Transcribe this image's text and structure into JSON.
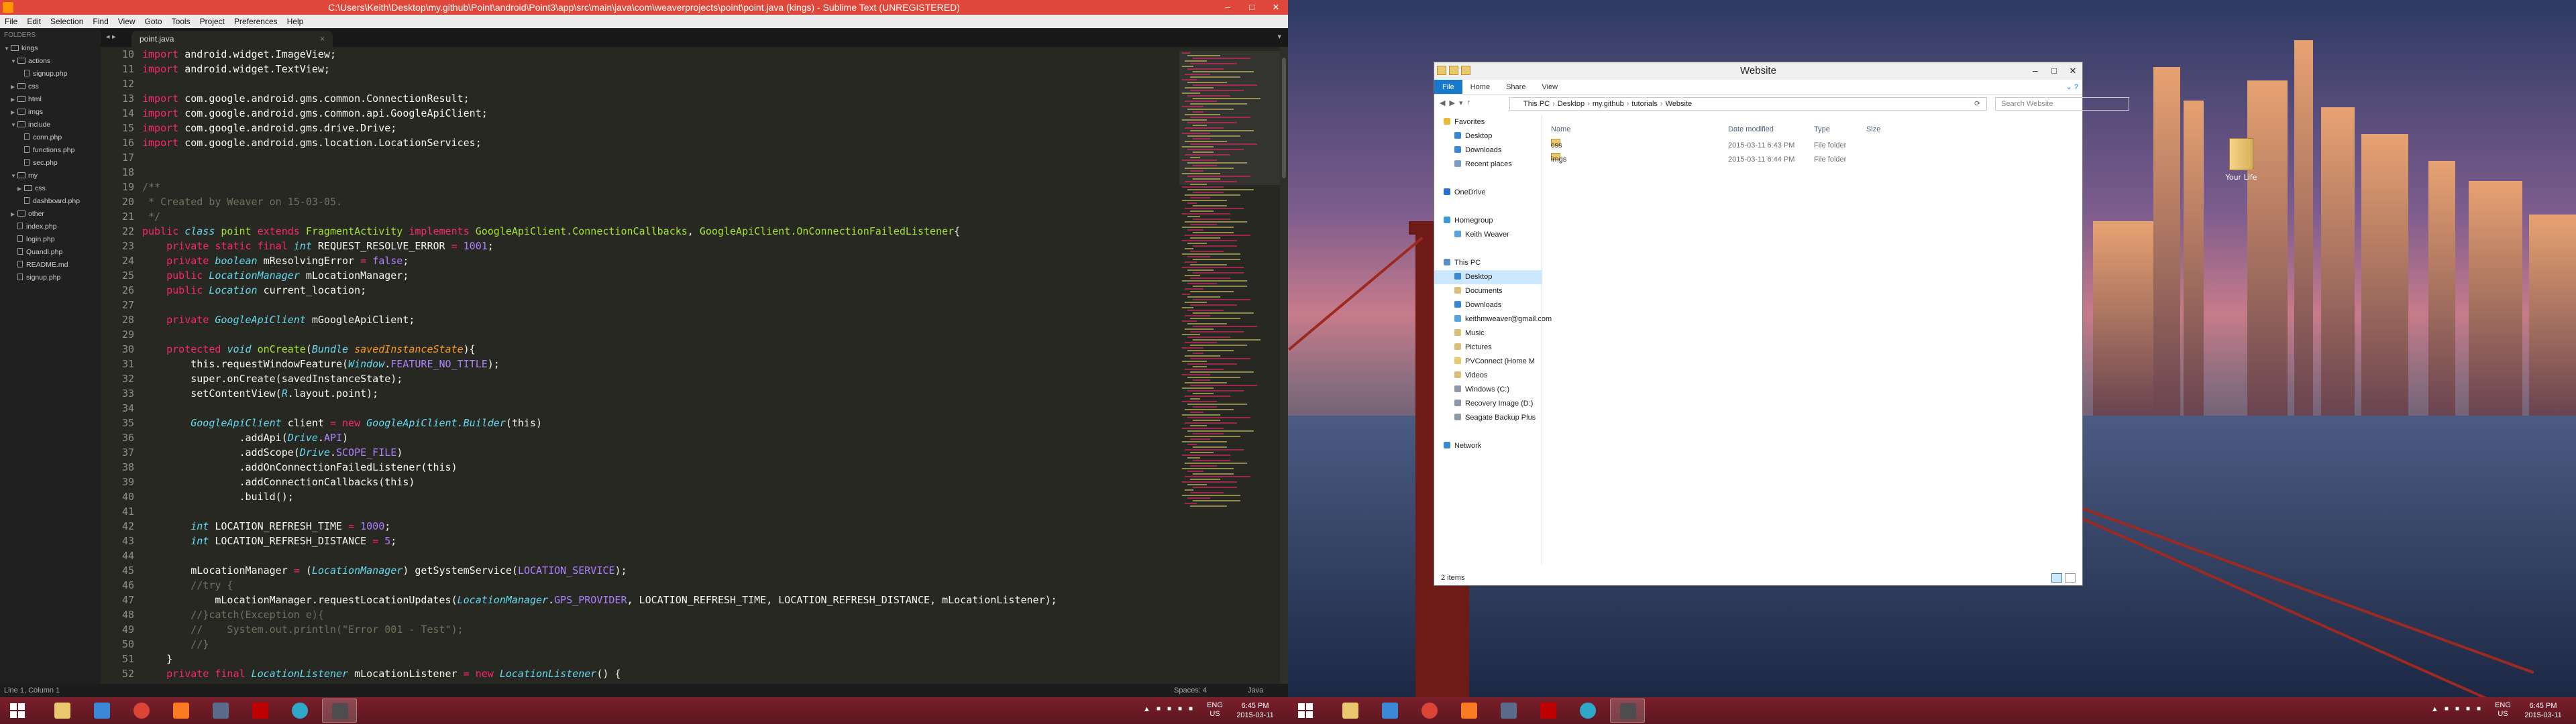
{
  "sublime": {
    "title": "C:\\Users\\Keith\\Desktop\\my.github\\Point\\android\\Point3\\app\\src\\main\\java\\com\\weaverprojects\\point\\point.java (kings) - Sublime Text (UNREGISTERED)",
    "menu": [
      "File",
      "Edit",
      "Selection",
      "Find",
      "View",
      "Goto",
      "Tools",
      "Project",
      "Preferences",
      "Help"
    ],
    "sidebar_header": "FOLDERS",
    "tree": [
      {
        "label": "kings",
        "kind": "folder",
        "open": true,
        "depth": 0
      },
      {
        "label": "actions",
        "kind": "folder",
        "open": true,
        "depth": 1
      },
      {
        "label": "signup.php",
        "kind": "file",
        "depth": 2
      },
      {
        "label": "css",
        "kind": "folder",
        "open": false,
        "depth": 1
      },
      {
        "label": "html",
        "kind": "folder",
        "open": false,
        "depth": 1
      },
      {
        "label": "imgs",
        "kind": "folder",
        "open": false,
        "depth": 1
      },
      {
        "label": "include",
        "kind": "folder",
        "open": true,
        "depth": 1
      },
      {
        "label": "conn.php",
        "kind": "file",
        "depth": 2
      },
      {
        "label": "functions.php",
        "kind": "file",
        "depth": 2
      },
      {
        "label": "sec.php",
        "kind": "file",
        "depth": 2
      },
      {
        "label": "my",
        "kind": "folder",
        "open": true,
        "depth": 1
      },
      {
        "label": "css",
        "kind": "folder",
        "open": false,
        "depth": 2
      },
      {
        "label": "dashboard.php",
        "kind": "file",
        "depth": 2
      },
      {
        "label": "other",
        "kind": "folder",
        "open": false,
        "depth": 1
      },
      {
        "label": "index.php",
        "kind": "file",
        "depth": 1
      },
      {
        "label": "login.php",
        "kind": "file",
        "depth": 1
      },
      {
        "label": "Quandl.php",
        "kind": "file",
        "depth": 1
      },
      {
        "label": "README.md",
        "kind": "file",
        "depth": 1
      },
      {
        "label": "signup.php",
        "kind": "file",
        "depth": 1
      }
    ],
    "tab": "point.java",
    "first_line": 10,
    "code": [
      [
        [
          "kw",
          "import "
        ],
        [
          "pl",
          "android.widget.ImageView;"
        ]
      ],
      [
        [
          "kw",
          "import "
        ],
        [
          "pl",
          "android.widget.TextView;"
        ]
      ],
      [],
      [
        [
          "kw",
          "import "
        ],
        [
          "pl",
          "com.google.android.gms.common.ConnectionResult;"
        ]
      ],
      [
        [
          "kw",
          "import "
        ],
        [
          "pl",
          "com.google.android.gms.common.api.GoogleApiClient;"
        ]
      ],
      [
        [
          "kw",
          "import "
        ],
        [
          "pl",
          "com.google.android.gms.drive.Drive;"
        ]
      ],
      [
        [
          "kw",
          "import "
        ],
        [
          "pl",
          "com.google.android.gms.location.LocationServices;"
        ]
      ],
      [],
      [],
      [
        [
          "cm",
          "/**"
        ]
      ],
      [
        [
          "cm",
          " * Created by Weaver on 15-03-05."
        ]
      ],
      [
        [
          "cm",
          " */"
        ]
      ],
      [
        [
          "kw",
          "public "
        ],
        [
          "ty",
          "class "
        ],
        [
          "cl",
          "point "
        ],
        [
          "kw",
          "extends "
        ],
        [
          "cl",
          "FragmentActivity "
        ],
        [
          "kw",
          "implements "
        ],
        [
          "cl",
          "GoogleApiClient.ConnectionCallbacks"
        ],
        [
          "pl",
          ", "
        ],
        [
          "cl",
          "GoogleApiClient.OnConnectionFailedListener"
        ],
        [
          "pl",
          "{"
        ]
      ],
      [
        [
          "pl",
          "    "
        ],
        [
          "kw",
          "private static final "
        ],
        [
          "ty",
          "int "
        ],
        [
          "pl",
          "REQUEST_RESOLVE_ERROR "
        ],
        [
          "kw",
          "= "
        ],
        [
          "nu",
          "1001"
        ],
        [
          "pl",
          ";"
        ]
      ],
      [
        [
          "pl",
          "    "
        ],
        [
          "kw",
          "private "
        ],
        [
          "ty",
          "boolean "
        ],
        [
          "pl",
          "mResolvingError "
        ],
        [
          "kw",
          "= "
        ],
        [
          "nu",
          "false"
        ],
        [
          "pl",
          ";"
        ]
      ],
      [
        [
          "pl",
          "    "
        ],
        [
          "kw",
          "public "
        ],
        [
          "ty",
          "LocationManager "
        ],
        [
          "pl",
          "mLocationManager;"
        ]
      ],
      [
        [
          "pl",
          "    "
        ],
        [
          "kw",
          "public "
        ],
        [
          "ty",
          "Location "
        ],
        [
          "pl",
          "current_location;"
        ]
      ],
      [],
      [
        [
          "pl",
          "    "
        ],
        [
          "kw",
          "private "
        ],
        [
          "ty",
          "GoogleApiClient "
        ],
        [
          "pl",
          "mGoogleApiClient;"
        ]
      ],
      [],
      [
        [
          "pl",
          "    "
        ],
        [
          "kw",
          "protected "
        ],
        [
          "ty",
          "void "
        ],
        [
          "fn",
          "onCreate"
        ],
        [
          "pl",
          "("
        ],
        [
          "ty",
          "Bundle "
        ],
        [
          "par",
          "savedInstanceState"
        ],
        [
          "pl",
          "){"
        ]
      ],
      [
        [
          "pl",
          "        this.requestWindowFeature("
        ],
        [
          "ty",
          "Window"
        ],
        [
          "pl",
          "."
        ],
        [
          "cn",
          "FEATURE_NO_TITLE"
        ],
        [
          "pl",
          ");"
        ]
      ],
      [
        [
          "pl",
          "        super.onCreate(savedInstanceState);"
        ]
      ],
      [
        [
          "pl",
          "        setContentView("
        ],
        [
          "ty",
          "R"
        ],
        [
          "pl",
          ".layout.point);"
        ]
      ],
      [],
      [
        [
          "pl",
          "        "
        ],
        [
          "ty",
          "GoogleApiClient "
        ],
        [
          "pl",
          "client "
        ],
        [
          "kw",
          "= new "
        ],
        [
          "ty",
          "GoogleApiClient.Builder"
        ],
        [
          "pl",
          "(this)"
        ]
      ],
      [
        [
          "pl",
          "                .addApi("
        ],
        [
          "ty",
          "Drive"
        ],
        [
          "pl",
          "."
        ],
        [
          "cn",
          "API"
        ],
        [
          "pl",
          ")"
        ]
      ],
      [
        [
          "pl",
          "                .addScope("
        ],
        [
          "ty",
          "Drive"
        ],
        [
          "pl",
          "."
        ],
        [
          "cn",
          "SCOPE_FILE"
        ],
        [
          "pl",
          ")"
        ]
      ],
      [
        [
          "pl",
          "                .addOnConnectionFailedListener(this)"
        ]
      ],
      [
        [
          "pl",
          "                .addConnectionCallbacks(this)"
        ]
      ],
      [
        [
          "pl",
          "                .build();"
        ]
      ],
      [],
      [
        [
          "pl",
          "        "
        ],
        [
          "ty",
          "int "
        ],
        [
          "pl",
          "LOCATION_REFRESH_TIME "
        ],
        [
          "kw",
          "= "
        ],
        [
          "nu",
          "1000"
        ],
        [
          "pl",
          ";"
        ]
      ],
      [
        [
          "pl",
          "        "
        ],
        [
          "ty",
          "int "
        ],
        [
          "pl",
          "LOCATION_REFRESH_DISTANCE "
        ],
        [
          "kw",
          "= "
        ],
        [
          "nu",
          "5"
        ],
        [
          "pl",
          ";"
        ]
      ],
      [],
      [
        [
          "pl",
          "        mLocationManager "
        ],
        [
          "kw",
          "= "
        ],
        [
          "pl",
          "("
        ],
        [
          "ty",
          "LocationManager"
        ],
        [
          "pl",
          ") getSystemService("
        ],
        [
          "cn",
          "LOCATION_SERVICE"
        ],
        [
          "pl",
          ");"
        ]
      ],
      [
        [
          "pl",
          "        "
        ],
        [
          "cm",
          "//try {"
        ]
      ],
      [
        [
          "pl",
          "            mLocationManager.requestLocationUpdates("
        ],
        [
          "ty",
          "LocationManager"
        ],
        [
          "pl",
          "."
        ],
        [
          "cn",
          "GPS_PROVIDER"
        ],
        [
          "pl",
          ", LOCATION_REFRESH_TIME, LOCATION_REFRESH_DISTANCE, mLocationListener);"
        ]
      ],
      [
        [
          "pl",
          "        "
        ],
        [
          "cm",
          "//}catch(Exception e){"
        ]
      ],
      [
        [
          "pl",
          "        "
        ],
        [
          "cm",
          "//    System.out.println(\"Error 001 - Test\");"
        ]
      ],
      [
        [
          "pl",
          "        "
        ],
        [
          "cm",
          "//}"
        ]
      ],
      [
        [
          "pl",
          "    }"
        ]
      ],
      [
        [
          "pl",
          "    "
        ],
        [
          "kw",
          "private final "
        ],
        [
          "ty",
          "LocationListener "
        ],
        [
          "pl",
          "mLocationListener "
        ],
        [
          "kw",
          "= new "
        ],
        [
          "ty",
          "LocationListener"
        ],
        [
          "pl",
          "() {"
        ]
      ]
    ],
    "status_left": "Line 1, Column 1",
    "status_spaces": "Spaces: 4",
    "status_lang": "Java"
  },
  "explorer": {
    "title": "Website",
    "ribbon": [
      "File",
      "Home",
      "Share",
      "View"
    ],
    "breadcrumb": [
      "This PC",
      "Desktop",
      "my.github",
      "tutorials",
      "Website"
    ],
    "search_placeholder": "Search Website",
    "nav": [
      {
        "label": "Favorites",
        "icon": "star-icon",
        "group": true
      },
      {
        "label": "Desktop",
        "icon": "desktop-icon"
      },
      {
        "label": "Downloads",
        "icon": "downloads-icon"
      },
      {
        "label": "Recent places",
        "icon": "recent-icon"
      },
      {
        "label": "",
        "icon": ""
      },
      {
        "label": "OneDrive",
        "icon": "cloud-icon",
        "group": true
      },
      {
        "label": "",
        "icon": ""
      },
      {
        "label": "Homegroup",
        "icon": "homegroup-icon",
        "group": true
      },
      {
        "label": "Keith Weaver",
        "icon": "user-icon"
      },
      {
        "label": "",
        "icon": ""
      },
      {
        "label": "This PC",
        "icon": "computer-icon",
        "group": true
      },
      {
        "label": "Desktop",
        "icon": "desktop-icon",
        "selected": true
      },
      {
        "label": "Documents",
        "icon": "documents-icon"
      },
      {
        "label": "Downloads",
        "icon": "downloads-icon"
      },
      {
        "label": "keithmweaver@gmail.com",
        "icon": "user-icon"
      },
      {
        "label": "Music",
        "icon": "music-icon"
      },
      {
        "label": "Pictures",
        "icon": "pictures-icon"
      },
      {
        "label": "PVConnect (Home M",
        "icon": "folder-icon"
      },
      {
        "label": "Videos",
        "icon": "videos-icon"
      },
      {
        "label": "Windows (C:)",
        "icon": "drive-icon"
      },
      {
        "label": "Recovery Image (D:)",
        "icon": "drive-icon"
      },
      {
        "label": "Seagate Backup Plus",
        "icon": "drive-icon"
      },
      {
        "label": "",
        "icon": ""
      },
      {
        "label": "Network",
        "icon": "network-icon",
        "group": true
      }
    ],
    "columns": [
      "Name",
      "Date modified",
      "Type",
      "Size"
    ],
    "files": [
      {
        "name": "css",
        "date": "2015-03-11 6:43 PM",
        "type": "File folder",
        "size": ""
      },
      {
        "name": "imgs",
        "date": "2015-03-11 6:44 PM",
        "type": "File folder",
        "size": ""
      }
    ],
    "status": "2 items"
  },
  "desktop_icon": "Your Life",
  "taskbar": {
    "lang": "ENG",
    "locale": "US",
    "time": "6:45 PM",
    "date": "2015-03-11"
  },
  "colors": {
    "sublime_title": "#e0473b",
    "taskbar": "#6a1b26",
    "explorer_accent": "#1979ca"
  }
}
